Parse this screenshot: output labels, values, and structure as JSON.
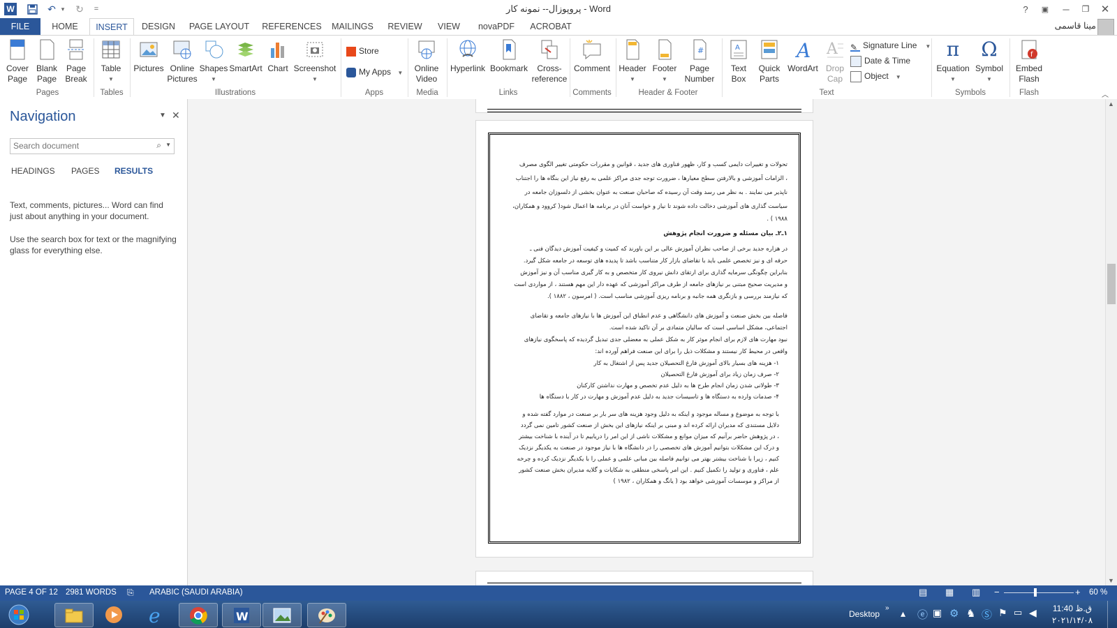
{
  "app": {
    "title": "پروپوزال-- نمونه کار - Word",
    "user": "مینا قاسمی",
    "help": "?",
    "colors": {
      "accent": "#2b579a",
      "ribbon_bg": "#ffffff",
      "doc_bg": "#f3f3f3"
    }
  },
  "qat": {
    "word_icon": "W",
    "save_icon": "save-icon",
    "undo_icon": "undo-icon",
    "redo_icon": "redo-icon",
    "customize": "="
  },
  "tabs": [
    "FILE",
    "HOME",
    "INSERT",
    "DESIGN",
    "PAGE LAYOUT",
    "REFERENCES",
    "MAILINGS",
    "REVIEW",
    "VIEW",
    "novaPDF",
    "ACROBAT"
  ],
  "ribbon": {
    "pages": {
      "cover": "Cover\nPage",
      "blank": "Blank\nPage",
      "break": "Page\nBreak",
      "group": "Pages"
    },
    "tables": {
      "table": "Table",
      "group": "Tables"
    },
    "illustrations": {
      "pictures": "Pictures",
      "online": "Online\nPictures",
      "shapes": "Shapes",
      "smartart": "SmartArt",
      "chart": "Chart",
      "screenshot": "Screenshot",
      "group": "Illustrations"
    },
    "apps": {
      "store": "Store",
      "myapps": "My Apps",
      "group": "Apps"
    },
    "media": {
      "video": "Online\nVideo",
      "group": "Media"
    },
    "links": {
      "hyperlink": "Hyperlink",
      "bookmark": "Bookmark",
      "crossref": "Cross-\nreference",
      "group": "Links"
    },
    "comments": {
      "comment": "Comment",
      "group": "Comments"
    },
    "headerfooter": {
      "header": "Header",
      "footer": "Footer",
      "pagenum": "Page\nNumber",
      "group": "Header & Footer"
    },
    "text": {
      "textbox": "Text\nBox",
      "quickparts": "Quick\nParts",
      "wordart": "WordArt",
      "dropcap": "Drop\nCap",
      "signature": "Signature Line",
      "datetime": "Date & Time",
      "object": "Object",
      "group": "Text"
    },
    "symbols": {
      "equation": "Equation",
      "symbol": "Symbol",
      "group": "Symbols"
    },
    "flash": {
      "embed": "Embed\nFlash",
      "group": "Flash"
    }
  },
  "nav": {
    "title": "Navigation",
    "search_placeholder": "Search document",
    "tabs": [
      "HEADINGS",
      "PAGES",
      "RESULTS"
    ],
    "help1": "Text, comments, pictures... Word can find just about anything in your document.",
    "help2": "Use the search box for text or the magnifying glass for everything else."
  },
  "doc": {
    "lines": [
      "تحولات و تغییرات دایمی کسب و کار، ظهور فناوری های جدید ، قوانین و مقررات حکومتی تغییر الگوی مصرف",
      "، الزامات آموزشی و بالارفتن سطح معیارها ، ضرورت توجه جدی مراکز علمی به رفع نیاز این بنگاه ها را اجتناب",
      "ناپذیر می نمایند . به نظر می رسد وقت آن رسیده که صاحبان صنعت به عنوان بخشی از دلسوزان جامعه در",
      "سیاست گذاری های آموزشی دخالت داده شوند تا نیاز و خواست آنان در برنامه ها اعمال شود( کروود و همکاران،",
      "۱۹۸۸ ) .",
      "۱ـ۲ـ بیان مسئله و ضرورت انجام پژوهش",
      "در هزاره جدید برخی از صاحب نظران آموزش عالی بر این باورند که کمیت و کیفیت آموزش دیدگان فنی ـ",
      "حرفه ای و نیز تخصص علمی باید با تقاضای بازار کار متناسب باشد تا پدیده های توسعه در جامعه شکل گیرد.",
      "بنابراین چگونگی سرمایه گذاری برای ارتقای دانش نیروی کار متخصص و به کار گیری مناسب آن و نیز آموزش",
      "و مدیریت صحیح مبتنی بر نیازهای جامعه از طرف مراکز آموزشی که عهده دار این مهم هستند ، از مواردی است",
      "که نیازمند بررسی و بازنگری همه جانبه و برنامه ریزی آموزشی مناسب است. ( امرسون ، ۱۸۸۲ ).",
      "فاصله بین بخش صنعت و آموزش های دانشگاهی و عدم انطباق این آموزش ها با نیازهای جامعه و تقاضای",
      "اجتماعی، مشکل اساسی است که سالیان متمادی بر آن تاکید شده است.",
      "نبود مهارت های لازم برای انجام موثر کار به شکل عملی به معضلی جدی تبدیل گردیده که پاسخگوی نیازهای",
      "واقعی در محیط کار نیستند و مشکلات ذیل را برای این صنعت فراهم آورده اند:",
      "۱- هزینه های بسیار بالای آموزش فارغ التحصیلان جدید پس از اشتغال به کار",
      "۲- صرف زمان زیاد برای آموزش فارغ التحصیلان",
      "۳- طولانی شدن زمان انجام طرح ها به دلیل عدم تخصص و مهارت نداشتن کارکنان",
      "۴- صدمات وارده به دستگاه ها و تاسیسات جدید به دلیل عدم آموزش و مهارت در کار با دستگاه ها",
      "با توجه به موضوع و مساله موجود و اینکه به دلیل وجود هزینه های سر بار بر صنعت در موارد گفته شده و",
      "دلایل مستندی که مدیران ارائه کرده اند و مبنی بر اینکه نیازهای این بخش از صنعت کشور تامین نمی گردد",
      "، در پژوهش حاضر برآنیم که میزان موانع و مشکلات ناشی از این امر را دریابیم تا در آینده با شناخت بیشتر",
      "و درک این مشکلات بتوانیم آموزش های تخصصی را در دانشگاه ها با نیاز موجود در صنعت به یکدیگر نزدیک",
      "کنیم ، زیرا با شناخت بیشتر بهتر می توانیم فاصله بین مبانی علمی و عملی را با یکدیگر نزدیک کرده و چرخه",
      "علم ، فناوری و تولید را تکمیل کنیم . این امر پاسخی منطقی به شکایات و گلایه مدیران بخش صنعت کشور",
      "از مراکز و موسسات آموزشی خواهد بود ( یانگ و همکاران ، ۱۹۸۲ )"
    ]
  },
  "status": {
    "page": "PAGE 4 OF 12",
    "words": "2981 WORDS",
    "lang": "ARABIC (SAUDI ARABIA)",
    "zoom": "60 %",
    "zoom_fraction": 0.45
  },
  "taskbar": {
    "desktop": "Desktop",
    "time": "11:40 ق.ظ",
    "date": "۲۰۲۱/۱۴/۰۸"
  }
}
